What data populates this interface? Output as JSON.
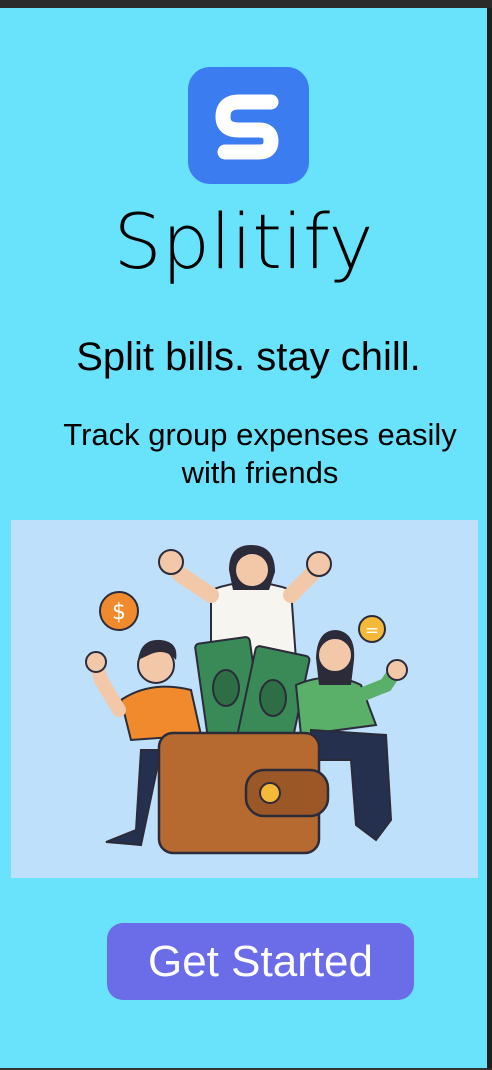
{
  "app": {
    "name": "Splitify",
    "logo_letter": "S",
    "tagline": "Split bills. stay chill.",
    "subtitle": "Track group expenses easily with friends"
  },
  "illustration": {
    "subject": "people-with-wallet-and-money-illustration",
    "coin_symbols": [
      "$",
      "="
    ]
  },
  "actions": {
    "get_started_label": "Get Started"
  },
  "colors": {
    "background": "#69e2fb",
    "logo_bg": "#3b7df0",
    "illustration_bg": "#bfe0fb",
    "button_bg": "#6b6de8",
    "button_text": "#ffffff"
  }
}
